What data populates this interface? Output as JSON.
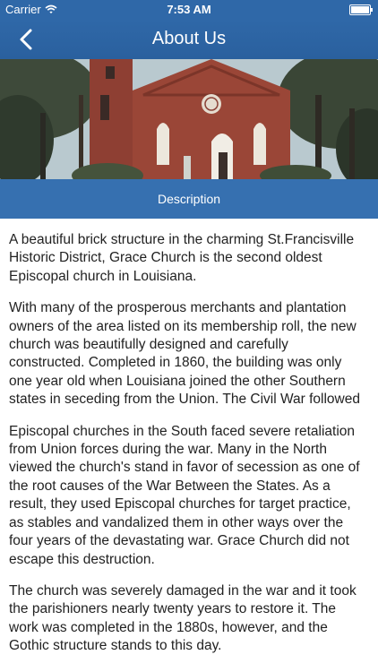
{
  "status_bar": {
    "carrier": "Carrier",
    "time": "7:53 AM"
  },
  "nav": {
    "title": "About Us",
    "back_icon": "chevron-left-icon"
  },
  "section": {
    "label": "Description"
  },
  "colors": {
    "nav_blue": "#2f68a8",
    "section_blue": "#3670b0"
  },
  "paragraphs": [
    "A beautiful brick structure in the charming St.Francisville Historic District, Grace Church is the second oldest Episcopal church in  Louisiana.",
    "With many of the prosperous merchants and plantation owners of the area listed on its membership roll, the new church was beautifully designed and carefully constructed. Completed in 1860, the building was only one year old when Louisiana joined the other Southern states in seceding from the Union. The Civil War followed",
    "Episcopal churches in the South faced severe retaliation from Union forces during the war. Many in the North viewed the church's stand in favor of secession as one of the root causes of the War Between the States. As a result, they used Episcopal churches for target practice, as stables and vandalized them in other ways over the four years of the devastating war. Grace Church did not escape this destruction.",
    "The church was severely damaged in the war and it took the parishioners nearly twenty years to restore it. The work was completed in the 1880s, however, and the Gothic structure stands to this day."
  ]
}
